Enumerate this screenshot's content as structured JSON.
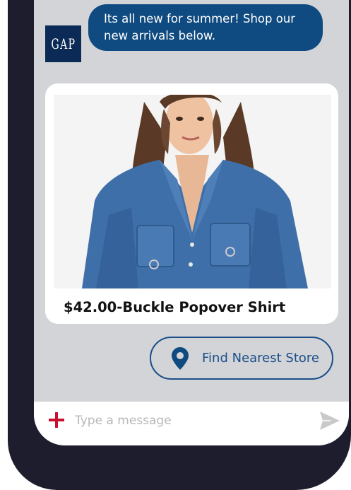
{
  "chat": {
    "brand_logo_text": "GAP",
    "message": "Its all new for summer! Shop our new arrivals below."
  },
  "product": {
    "title": "$42.00-Buckle Popover Shirt",
    "image_alt": "Woman wearing a denim buckle popover shirt"
  },
  "actions": {
    "find_store_label": "Find Nearest Store",
    "find_store_icon": "map-pin-icon"
  },
  "composer": {
    "placeholder": "Type a message",
    "add_icon": "plus-icon",
    "send_icon": "send-icon"
  },
  "colors": {
    "bubble": "#0f4a80",
    "brand_navy": "#0b2a55",
    "accent_red": "#c8102e",
    "screen_bg": "#d3d4d7",
    "frame": "#1e1d2e"
  }
}
